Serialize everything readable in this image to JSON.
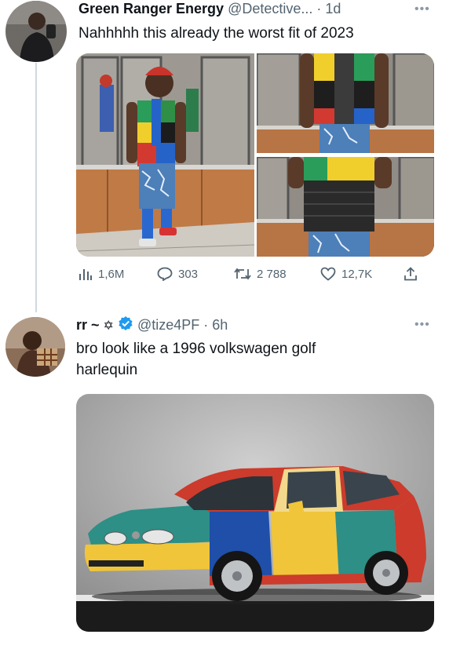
{
  "tweet1": {
    "display_name": "Green Ranger Energy",
    "handle": "@Detective...",
    "time": "· 1d",
    "text": "Nahhhhh this already the worst fit of 2023",
    "media": [
      {
        "icon": "photo-elevator-full-outfit"
      },
      {
        "icon": "photo-vest-closeup-top"
      },
      {
        "icon": "photo-vest-closeup-bottom"
      }
    ],
    "metrics": {
      "views": "1,6M",
      "replies": "303",
      "retweets": "2 788",
      "likes": "12,7K"
    }
  },
  "tweet2": {
    "display_name": "rr ~",
    "name_symbol": "✡",
    "handle": "@tize4PF",
    "time": "· 6h",
    "text_line1": "bro look like a 1996 volkswagen golf",
    "text_line2": "harlequin",
    "media": {
      "icon": "photo-harlequin-golf-car"
    }
  },
  "icons": {
    "more": "more-icon",
    "views": "bar-chart-icon",
    "reply": "reply-icon",
    "retweet": "retweet-icon",
    "like": "heart-icon",
    "share": "share-icon",
    "verified": "verified-badge-icon"
  },
  "colors": {
    "verified_blue": "#1d9bf0",
    "text_secondary": "#536471",
    "divider": "#cfd9de"
  }
}
